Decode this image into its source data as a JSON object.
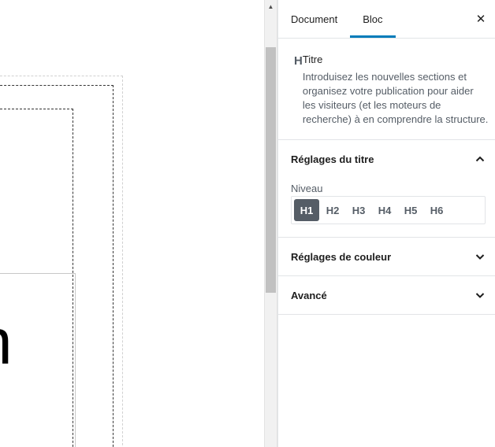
{
  "canvas": {
    "glyph": "n"
  },
  "sidebar": {
    "tabs": [
      {
        "label": "Document"
      },
      {
        "label": "Bloc"
      }
    ],
    "active_tab": "Bloc",
    "close_icon": "close-icon",
    "block_card": {
      "icon_letter": "H",
      "title": "Titre",
      "description": "Introduisez les nouvelles sections et organisez votre publication pour aider les visiteurs (et les moteurs de recherche) à en comprendre la structure."
    },
    "panels": [
      {
        "title": "Réglages du titre",
        "expanded": true
      },
      {
        "title": "Réglages de couleur",
        "expanded": false
      },
      {
        "title": "Avancé",
        "expanded": false
      }
    ],
    "heading_settings": {
      "level_label": "Niveau",
      "levels": [
        "H1",
        "H2",
        "H3",
        "H4",
        "H5",
        "H6"
      ],
      "selected_level": "H1"
    }
  },
  "colors": {
    "accent": "#007cba",
    "selected_level_bg": "#555d66",
    "muted_text": "#555d66",
    "border": "#e2e4e7"
  }
}
